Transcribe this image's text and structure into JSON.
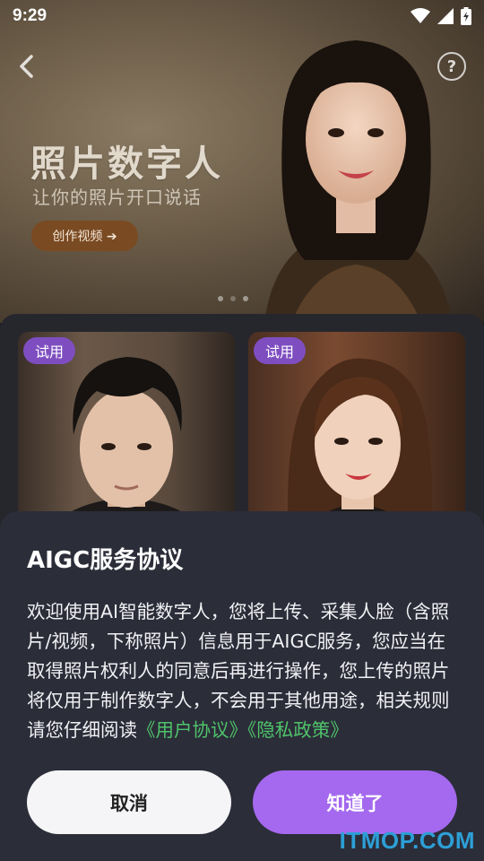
{
  "status": {
    "time": "9:29"
  },
  "hero": {
    "title": "照片数字人",
    "subtitle": "让你的照片开口说话",
    "cta_label": "创作视频 ➔",
    "help_label": "?"
  },
  "cards": [
    {
      "badge": "试用"
    },
    {
      "badge": "试用"
    }
  ],
  "dialog": {
    "title": "AIGC服务协议",
    "body": "欢迎使用AI智能数字人，您将上传、采集人脸（含照片/视频，下称照片）信息用于AIGC服务，您应当在取得照片权利人的同意后再进行操作，您上传的照片将仅用于制作数字人，不会用于其他用途，相关规则请您仔细阅读",
    "link_user_agreement": "《用户协议》",
    "link_privacy": "《隐私政策》",
    "cancel_label": "取消",
    "ok_label": "知道了"
  },
  "watermark": "ITMOP.COM",
  "colors": {
    "accent": "#a469ee",
    "badge": "#7e4ec0",
    "link": "#4fc36a",
    "sheet_bg": "#2b2d39"
  }
}
